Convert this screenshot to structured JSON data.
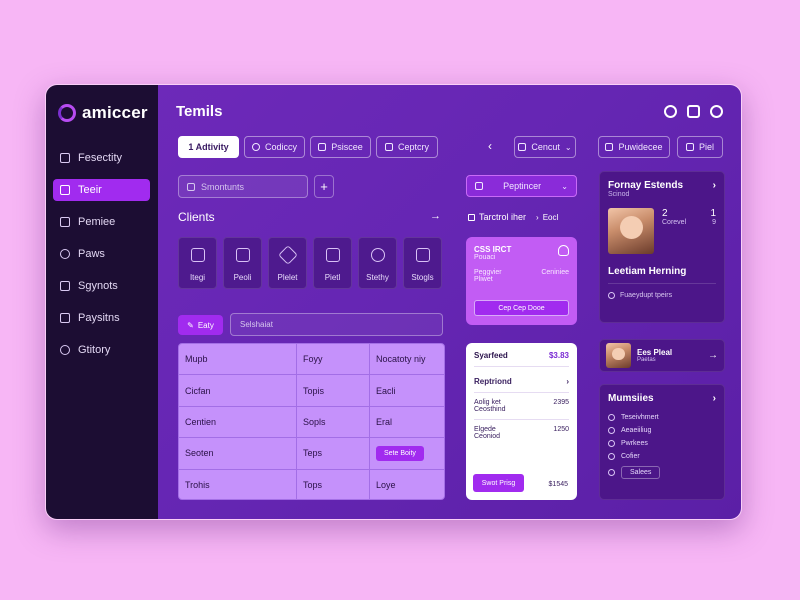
{
  "app": {
    "name": "amiccer"
  },
  "sidebar": {
    "items": [
      {
        "label": "Fesectity",
        "icon": "lock-icon",
        "active": false
      },
      {
        "label": "Teeir",
        "icon": "user-icon",
        "active": true
      },
      {
        "label": "Pemiee",
        "icon": "calendar-icon",
        "active": false
      },
      {
        "label": "Paws",
        "icon": "chat-icon",
        "active": false
      },
      {
        "label": "Sgynots",
        "icon": "document-icon",
        "active": false
      },
      {
        "label": "Paysitns",
        "icon": "card-icon",
        "active": false
      },
      {
        "label": "Gtitory",
        "icon": "history-icon",
        "active": false
      }
    ]
  },
  "header": {
    "title": "Temils"
  },
  "tabs": [
    {
      "label": "1 Adtivity"
    },
    {
      "label": "Codiccy"
    },
    {
      "label": "Psiscee"
    },
    {
      "label": "Ceptcry"
    }
  ],
  "toolbar": {
    "back_label": "‹",
    "filter_label": "Cencut",
    "export_label": "Puwidecee",
    "print_label": "Piel"
  },
  "search": {
    "placeholder": "Smontunts",
    "plus": "+"
  },
  "clients": {
    "title": "Clients",
    "tiles": [
      {
        "label": "Itegi"
      },
      {
        "label": "Peoli"
      },
      {
        "label": "Plelet"
      },
      {
        "label": "Pietl"
      },
      {
        "label": "Stethy"
      },
      {
        "label": "Stogls"
      }
    ]
  },
  "entry": {
    "button": "Eaty",
    "filter_placeholder": "Selshaiat"
  },
  "table": {
    "rows": [
      [
        "Mupb",
        "Foyy",
        "Nocatoty niy"
      ],
      [
        "Cicfan",
        "Topis",
        "Eacli"
      ],
      [
        "Centien",
        "Sopls",
        "Eral"
      ],
      [
        "Seoten",
        "Teps",
        "Sete Boity"
      ],
      [
        "Trohis",
        "Tops",
        "Loye"
      ]
    ]
  },
  "action_panel": {
    "dropdown": "Peptincer",
    "link_label": "Tarctrol iher",
    "link_extra": "Eocl",
    "card_title": "CSS IRCT",
    "card_sub": "Pouaci",
    "card_line1": "Peggvier",
    "card_line2": "Pliwet",
    "card_side": "Ceniniee",
    "card_button": "Cep Cep Dooe"
  },
  "summary": {
    "title": "Syarfeed",
    "amount": "$3.83",
    "sub_title": "Reptriond",
    "rows": [
      {
        "label": "Aolig ket",
        "sub": "Ceosthind",
        "value": "2395"
      },
      {
        "label": "Elgede",
        "sub": "Ceoniod",
        "value": "1250"
      }
    ],
    "button": "Swot Prisg",
    "button_value": "$1545"
  },
  "profile": {
    "name": "Fornay Estends",
    "role": "Scinod",
    "stat1": "2",
    "stat1_sub": "Corevel",
    "stat2": "1",
    "stat2_sub": "9",
    "title": "Leetiam Herning",
    "meta": "Fuaeydupt tpeirs"
  },
  "mini_profile": {
    "name": "Ees Pleal",
    "sub": "Paetas"
  },
  "messages": {
    "title": "Mumsiies",
    "items": [
      "Teseivhmert",
      "Aeaeiiliug",
      "Pwrkees",
      "Cofier"
    ],
    "button": "Salees"
  }
}
